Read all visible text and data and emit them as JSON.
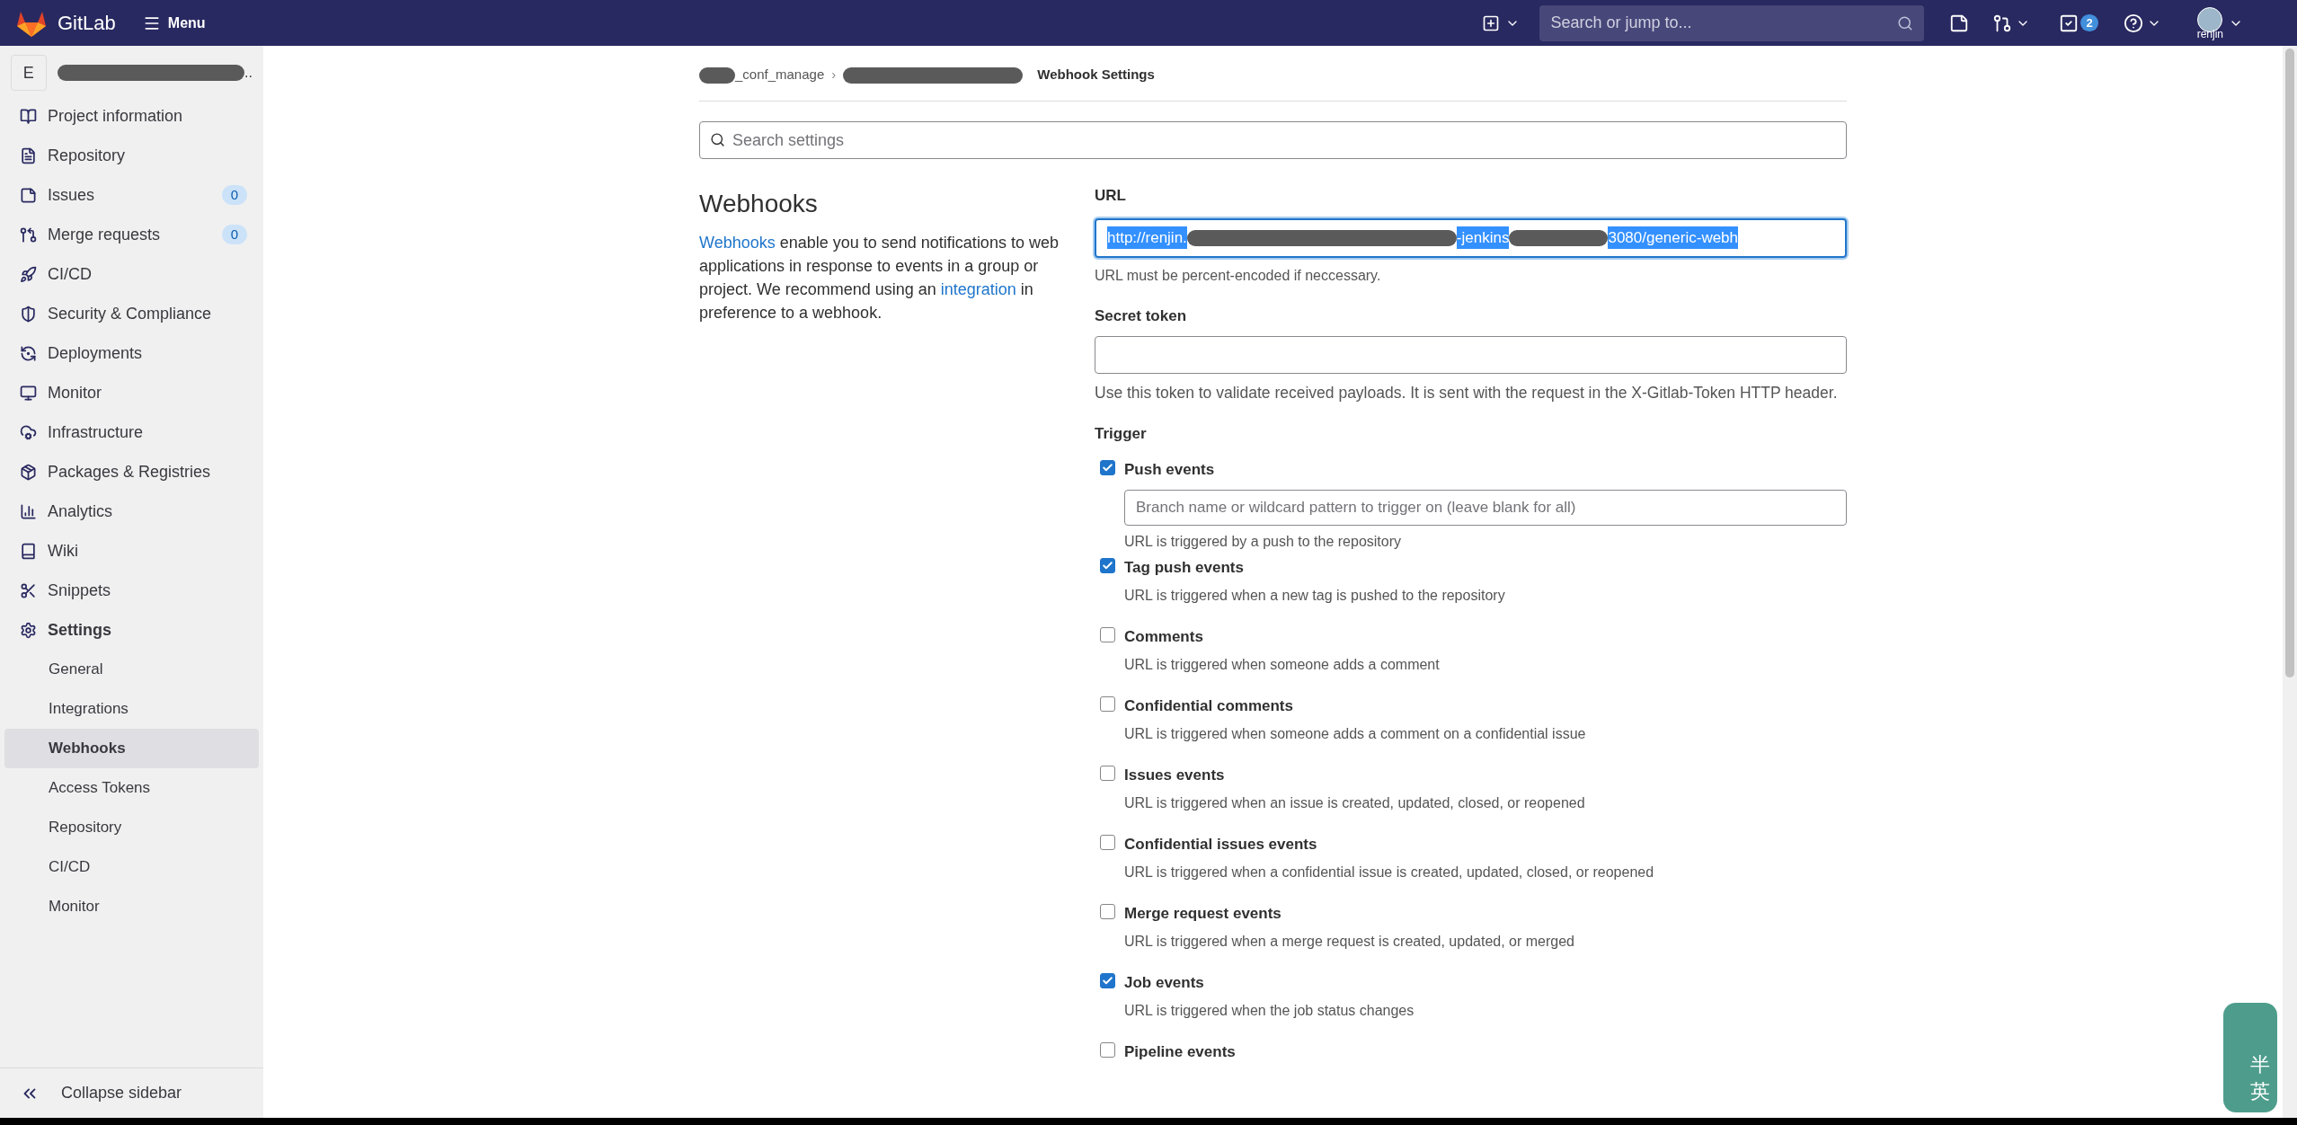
{
  "topbar": {
    "brand": "GitLab",
    "menu": "Menu",
    "search": {
      "placeholder": "Search or jump to..."
    },
    "todo_count": "2",
    "user": "renjin"
  },
  "sidebar": {
    "project_initial": "E",
    "project_name": "..",
    "items": [
      {
        "label": "Project information",
        "kind": "project"
      },
      {
        "label": "Repository",
        "kind": "repository"
      },
      {
        "label": "Issues",
        "kind": "issues",
        "badge": "0"
      },
      {
        "label": "Merge requests",
        "kind": "merge",
        "badge": "0"
      },
      {
        "label": "CI/CD",
        "kind": "cicd"
      },
      {
        "label": "Security & Compliance",
        "kind": "security"
      },
      {
        "label": "Deployments",
        "kind": "deployments"
      },
      {
        "label": "Monitor",
        "kind": "monitor"
      },
      {
        "label": "Infrastructure",
        "kind": "infrastructure"
      },
      {
        "label": "Packages & Registries",
        "kind": "packages"
      },
      {
        "label": "Analytics",
        "kind": "analytics"
      },
      {
        "label": "Wiki",
        "kind": "wiki"
      },
      {
        "label": "Snippets",
        "kind": "snippets"
      },
      {
        "label": "Settings",
        "kind": "settings",
        "children": [
          {
            "label": "General",
            "selected": false
          },
          {
            "label": "Integrations",
            "selected": false
          },
          {
            "label": "Webhooks",
            "selected": true
          },
          {
            "label": "Access Tokens",
            "selected": false
          },
          {
            "label": "Repository",
            "selected": false
          },
          {
            "label": "CI/CD",
            "selected": false
          },
          {
            "label": "Monitor",
            "selected": false
          }
        ]
      }
    ],
    "collapse": "Collapse sidebar"
  },
  "breadcrumb": {
    "project": "_conf_manage",
    "separator": "›",
    "current": "Webhook Settings"
  },
  "settings_search": {
    "placeholder": "Search settings"
  },
  "intro": {
    "title": "Webhooks",
    "link1": "Webhooks",
    "text1": " enable you to send notifications to web applications in response to events in a group or project. We recommend using an ",
    "link2": "integration",
    "text2": " in preference to a webhook."
  },
  "url": {
    "label": "URL",
    "value_parts": [
      "http://renjin.",
      "-jenkins",
      "3080/generic-webh"
    ],
    "selected": true,
    "help": "URL must be percent-encoded if neccessary."
  },
  "secret_token": {
    "label": "Secret token",
    "help": "Use this token to validate received payloads. It is sent with the request in the X-Gitlab-Token HTTP header."
  },
  "trigger": {
    "label": "Trigger",
    "events": [
      {
        "label": "Push events",
        "checked": true,
        "branch_placeholder": "Branch name or wildcard pattern to trigger on (leave blank for all)",
        "help": "URL is triggered by a push to the repository"
      },
      {
        "label": "Tag push events",
        "checked": true,
        "help": "URL is triggered when a new tag is pushed to the repository"
      },
      {
        "label": "Comments",
        "checked": false,
        "help": "URL is triggered when someone adds a comment"
      },
      {
        "label": "Confidential comments",
        "checked": false,
        "help": "URL is triggered when someone adds a comment on a confidential issue"
      },
      {
        "label": "Issues events",
        "checked": false,
        "help": "URL is triggered when an issue is created, updated, closed, or reopened"
      },
      {
        "label": "Confidential issues events",
        "checked": false,
        "help": "URL is triggered when a confidential issue is created, updated, closed, or reopened"
      },
      {
        "label": "Merge request events",
        "checked": false,
        "help": "URL is triggered when a merge request is created, updated, or merged"
      },
      {
        "label": "Job events",
        "checked": true,
        "help": "URL is triggered when the job status changes"
      },
      {
        "label": "Pipeline events",
        "checked": false
      }
    ]
  },
  "floating_widget": {
    "chars": [
      "半",
      "英"
    ]
  }
}
